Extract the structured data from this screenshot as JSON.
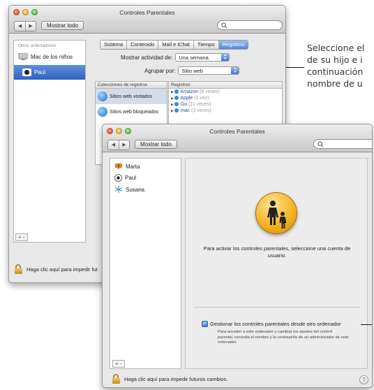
{
  "callout": {
    "lines": [
      "Seleccione el",
      "de su hijo e i",
      "continuación",
      "nombre de u"
    ]
  },
  "back_window": {
    "title": "Controles Parentales",
    "show_all": "Mostrar todo",
    "sidebar_header": "Otros ordenadores",
    "sidebar_items": [
      "Mac de los niños",
      "Paul"
    ],
    "tabs": [
      "Sistema",
      "Contenido",
      "Mail e iChat",
      "Tiempo",
      "Registros"
    ],
    "active_tab": "Registros",
    "show_activity_label": "Mostrar actividad de:",
    "show_activity_value": "Una semana",
    "group_by_label": "Agrupar por:",
    "group_by_value": "Sitio web",
    "collections_header": "Colecciones de registros",
    "collections": [
      "Sitios web visitados",
      "Sitios web bloqueados"
    ],
    "logs_header": "Registros",
    "logs": [
      {
        "name": "Amazon",
        "count": "(6 veces)"
      },
      {
        "name": "Apple",
        "count": "(1 vez)"
      },
      {
        "name": "Go",
        "count": "(11 veces)"
      },
      {
        "name": "mac",
        "count": "(3 veces)"
      }
    ],
    "plus_minus": "+ -",
    "lock_text": "Haga clic aquí para impedir fut"
  },
  "front_window": {
    "title": "Controles Parentales",
    "show_all": "Mostrar todo",
    "users": [
      "Marta",
      "Paul",
      "Susana"
    ],
    "plus_minus": "+ -",
    "message": "Para activar los controles parentales, seleccione una cuenta de usuario.",
    "checkbox_label": "Gestionar los controles parentales desde otro ordenador",
    "checkbox_checked": true,
    "checkbox_help": "Para acceder a este ordenador y cambiar los ajustes del control parental, necesita el nombre y la contraseña de un administrador de este ordenador.",
    "lock_text": "Haga clic aquí para impedir futuros cambios.",
    "help_symbol": "?"
  },
  "colors": {
    "selection": "#3a6fcb",
    "icon_yellow": "#f2b01e",
    "link_blue": "#1e4fa8"
  }
}
